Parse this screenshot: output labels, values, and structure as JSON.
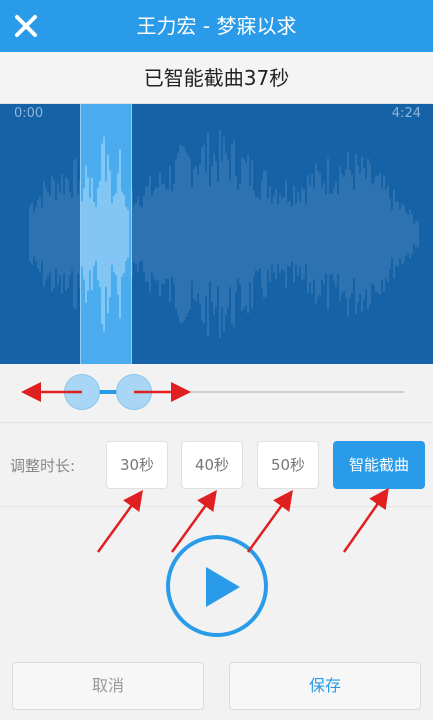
{
  "header": {
    "title": "王力宏 - 梦寐以求",
    "close_icon": "close-icon"
  },
  "status": {
    "message": "已智能截曲37秒"
  },
  "waveform": {
    "start_time": "0:00",
    "end_time": "4:24",
    "selection_start_fraction": 0.185,
    "selection_end_fraction": 0.305
  },
  "duration": {
    "label": "调整时长:",
    "options": [
      "30秒",
      "40秒",
      "50秒"
    ],
    "smart_label": "智能截曲"
  },
  "player": {
    "play_icon": "play-icon"
  },
  "actions": {
    "cancel": "取消",
    "save": "保存"
  },
  "colors": {
    "accent": "#2a9be8",
    "wave_bg": "#1563a6",
    "annotation_arrow": "#e02020"
  }
}
